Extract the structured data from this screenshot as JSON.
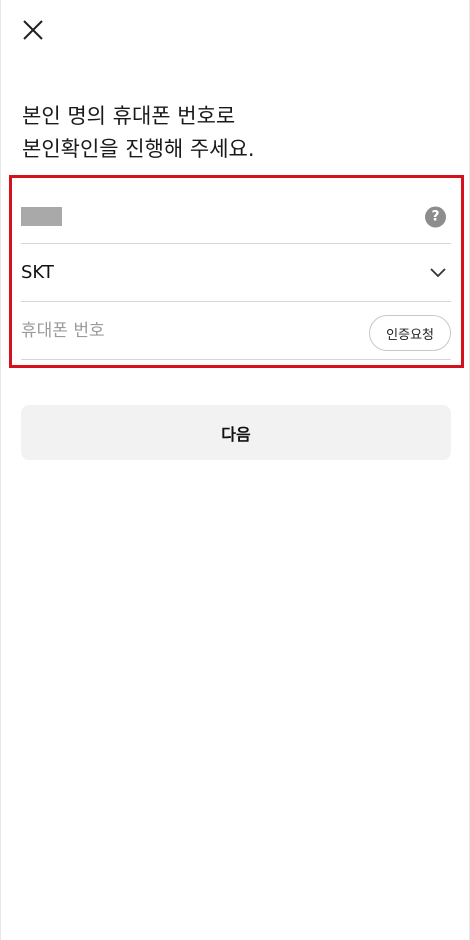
{
  "header": {
    "close_icon": "close-icon"
  },
  "headline": {
    "line1": "본인 명의 휴대폰 번호로",
    "line2": "본인확인을 진행해 주세요."
  },
  "form": {
    "name_help_icon": "question-icon",
    "name_help_glyph": "?",
    "carrier": {
      "selected": "SKT",
      "icon": "chevron-down-icon"
    },
    "phone": {
      "placeholder": "휴대폰 번호",
      "value": ""
    },
    "verify_button": "인증요청"
  },
  "next_button": "다음",
  "colors": {
    "highlight_border": "#d4121d",
    "next_button_bg": "#f2f2f2",
    "help_icon_bg": "#8d8d8d"
  }
}
